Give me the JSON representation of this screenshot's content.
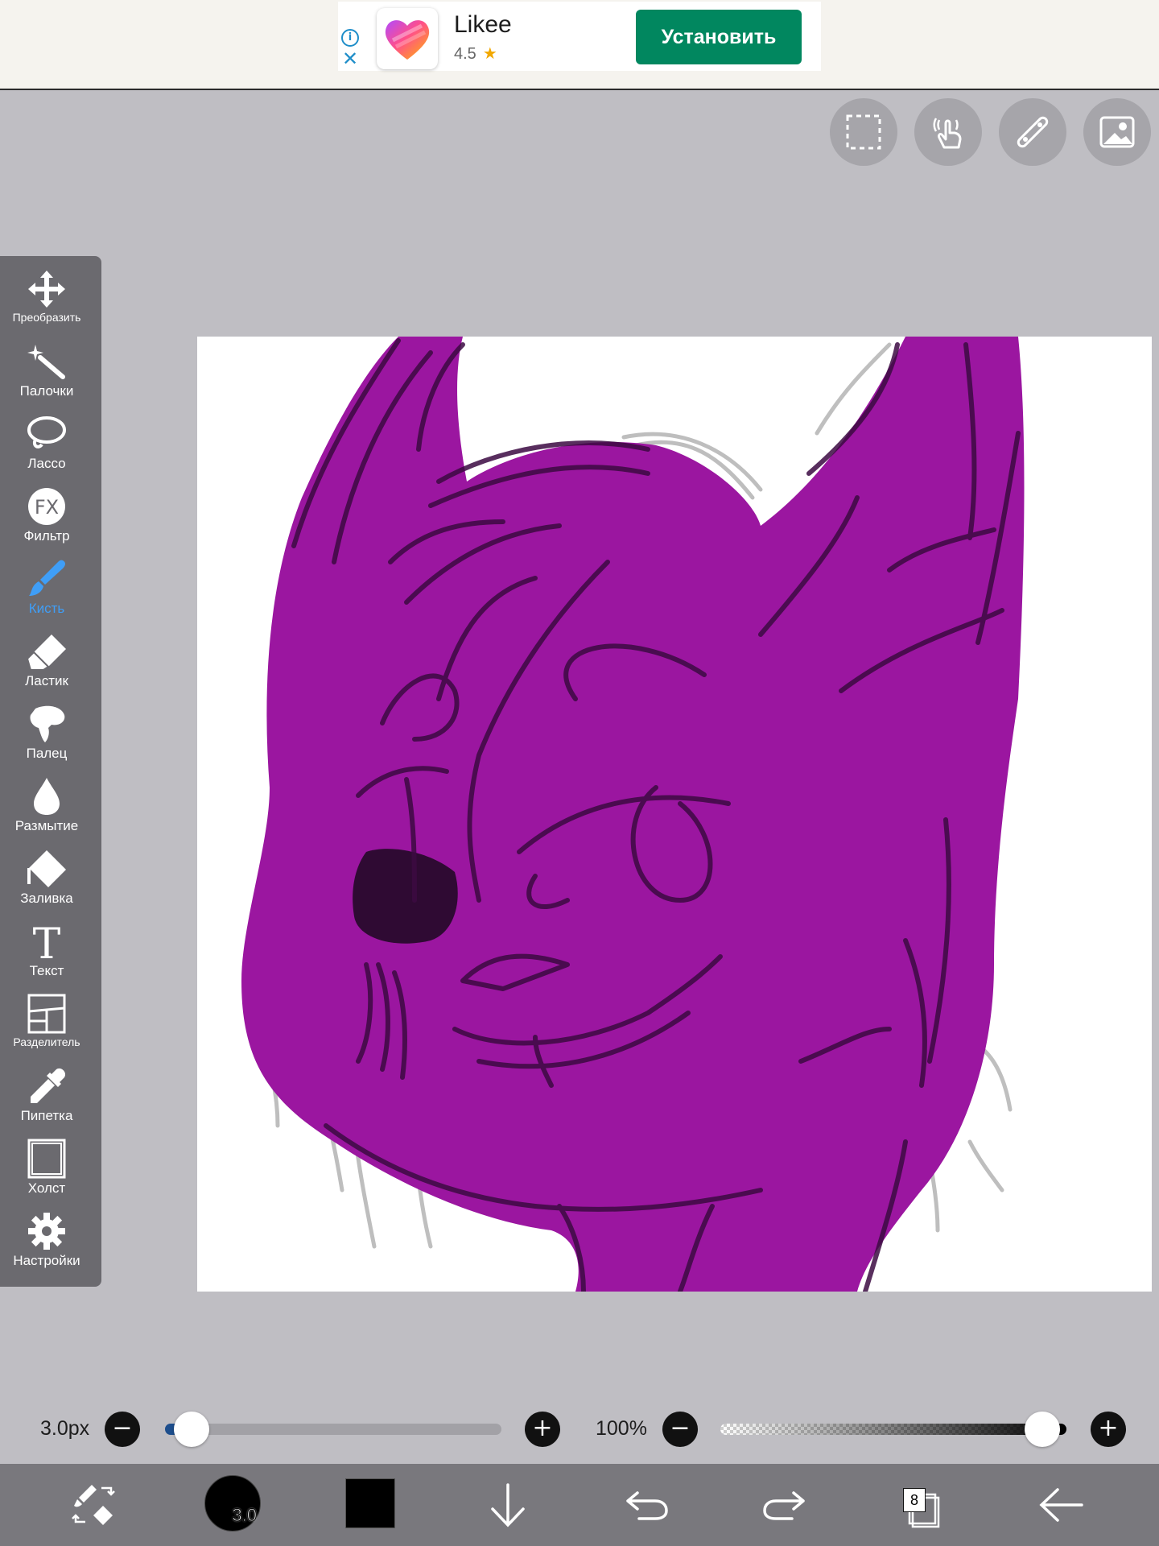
{
  "ad": {
    "app_name": "Likee",
    "rating": "4.5",
    "install_label": "Установить",
    "info_icon": "info-icon",
    "close_icon": "close-icon"
  },
  "top_buttons": [
    "selection-icon",
    "touch-gesture-icon",
    "ruler-icon",
    "image-reference-icon"
  ],
  "toolbar": {
    "tools": [
      {
        "label": "Преобразить",
        "icon": "move-arrows-icon"
      },
      {
        "label": "Палочки",
        "icon": "magic-wand-icon"
      },
      {
        "label": "Лассо",
        "icon": "lasso-icon"
      },
      {
        "label": "Фильтр",
        "icon": "fx-icon"
      },
      {
        "label": "Кисть",
        "icon": "brush-icon",
        "active": true
      },
      {
        "label": "Ластик",
        "icon": "eraser-icon"
      },
      {
        "label": "Палец",
        "icon": "finger-smudge-icon"
      },
      {
        "label": "Размытие",
        "icon": "blur-drop-icon"
      },
      {
        "label": "Заливка",
        "icon": "fill-bucket-icon"
      },
      {
        "label": "Текст",
        "icon": "text-icon"
      },
      {
        "label": "Разделитель",
        "icon": "frame-divider-icon"
      },
      {
        "label": "Пипетка",
        "icon": "eyedropper-icon"
      },
      {
        "label": "Холст",
        "icon": "canvas-icon"
      },
      {
        "label": "Настройки",
        "icon": "settings-gear-icon"
      }
    ]
  },
  "brush": {
    "size_label": "3.0px",
    "size_fraction": 0.08,
    "opacity_label": "100%",
    "opacity_fraction": 1.0
  },
  "bottom_bar": {
    "brush_size_value": "3.0",
    "current_color": "#000000",
    "layers_count": "8"
  },
  "colors": {
    "fill_purple": "#9b16a0",
    "accent_blue": "#3f9ef7",
    "install_green": "#01875f"
  }
}
